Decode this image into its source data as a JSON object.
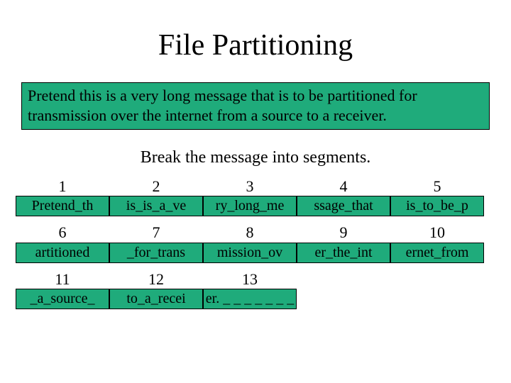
{
  "title": "File Partitioning",
  "message": "Pretend this is a very long message that is to be partitioned for transmission over the internet from a source to a receiver.",
  "subtitle": "Break the message into segments.",
  "segments": [
    {
      "n": "1",
      "text": "Pretend_th"
    },
    {
      "n": "2",
      "text": "is_is_a_ve"
    },
    {
      "n": "3",
      "text": "ry_long_me"
    },
    {
      "n": "4",
      "text": "ssage_that"
    },
    {
      "n": "5",
      "text": "is_to_be_p"
    },
    {
      "n": "6",
      "text": "artitioned"
    },
    {
      "n": "7",
      "text": "_for_trans"
    },
    {
      "n": "8",
      "text": "mission_ov"
    },
    {
      "n": "9",
      "text": "er_the_int"
    },
    {
      "n": "10",
      "text": "ernet_from"
    },
    {
      "n": "11",
      "text": "_a_source_"
    },
    {
      "n": "12",
      "text": "to_a_recei"
    },
    {
      "n": "13",
      "text": "er. _ _ _ _ _ _ _"
    }
  ],
  "colors": {
    "segment_fill": "#1fab7b",
    "border": "#000000"
  }
}
